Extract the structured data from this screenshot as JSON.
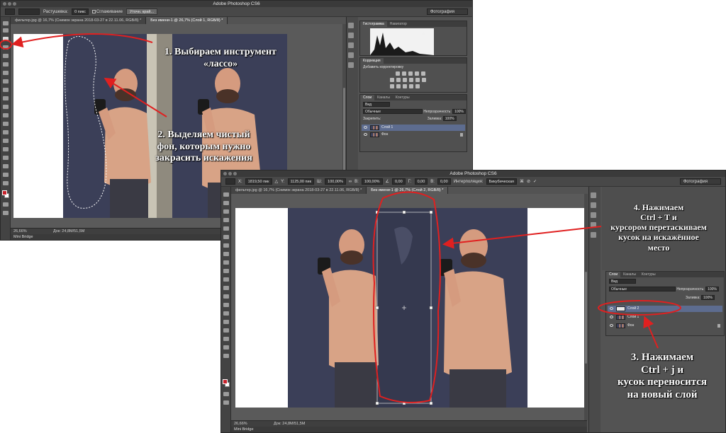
{
  "window1": {
    "title": "Adobe Photoshop CS6",
    "options": {
      "feather_label": "Растушевка:",
      "feather_value": "0 пикс",
      "antialias_label": "Сглаживание",
      "refine_button": "Уточн. край...",
      "workspace": "Фотография"
    },
    "tabs": [
      "фильтер.jpg @ 16,7% (Снимок экрана 2018-03-27 в 22.11.06, RGB/8) *",
      "Без имени-1 @ 26,7% (Слой 1, RGB/8) *"
    ],
    "status": {
      "zoom": "26,66%",
      "doc": "Док: 24,8M/51,5M"
    },
    "mini_bridge": "Mini Bridge",
    "panels": {
      "histogram_tabs": [
        "Гистограмма",
        "Навигатор"
      ],
      "adjustments_tab": "Коррекция",
      "adjustments_title": "Добавить корректировку",
      "layers_tabs": [
        "Слои",
        "Каналы",
        "Контуры"
      ],
      "kind": "Вид",
      "blend_mode": "Обычные",
      "opacity_label": "Непрозрачность:",
      "opacity_value": "100%",
      "lock_label": "Закрепить:",
      "fill_label": "Заливка:",
      "fill_value": "100%",
      "layers": [
        {
          "name": "Слой 1",
          "selected": true,
          "locked": false
        },
        {
          "name": "Фон",
          "selected": false,
          "locked": true
        }
      ]
    }
  },
  "window2": {
    "title": "Adobe Photoshop CS6",
    "options": {
      "x_label": "X:",
      "x_value": "1819,50 пик",
      "y_label": "Y:",
      "y_value": "1125,00 пик",
      "w_label": "Ш:",
      "w_value": "100,00%",
      "h_label": "В:",
      "h_value": "100,00%",
      "angle_value": "0,00",
      "hskew_label": "Г:",
      "hskew_value": "0,00",
      "vskew_label": "В:",
      "vskew_value": "0,00",
      "interp_label": "Интерполяция:",
      "interp_value": "Бикубическая",
      "workspace": "Фотография"
    },
    "tabs": [
      "фильтер.jpg @ 16,7% (Снимок экрана 2018-03-27 в 22.11.06, RGB/8) *",
      "Без имени-1 @ 26,7% (Слой 2, RGB/8) *"
    ],
    "status": {
      "zoom": "26,66%",
      "doc": "Док: 24,8M/51,5M"
    },
    "mini_bridge": "Mini Bridge",
    "panels": {
      "layers_tabs": [
        "Слои",
        "Каналы",
        "Контуры"
      ],
      "kind": "Вид",
      "blend_mode": "Обычные",
      "opacity_label": "Непрозрачность:",
      "opacity_value": "100%",
      "fill_label": "Заливка:",
      "fill_value": "100%",
      "layers": [
        {
          "name": "Слой 2",
          "selected": true,
          "locked": false
        },
        {
          "name": "Слой 1",
          "selected": false,
          "locked": false
        },
        {
          "name": "Фон",
          "selected": false,
          "locked": true
        }
      ]
    }
  },
  "annotations": {
    "step1": [
      "1. Выбираем инструмент",
      "«лассо»"
    ],
    "step2": [
      "2. Выделяем чистый",
      "фон, которым нужно",
      "закрасить искажения"
    ],
    "step3": [
      "3. Нажимаем",
      "Ctrl + j и",
      "кусок переносится",
      "на новый слой"
    ],
    "step4": [
      "4. Нажимаем",
      "Ctrl + T и",
      "курсором перетаскиваем",
      "кусок на искажённое",
      "место"
    ]
  },
  "colors": {
    "annotation_red": "#e02020",
    "foreground": "#c8232c",
    "selected_layer": "#5d6c8f"
  }
}
